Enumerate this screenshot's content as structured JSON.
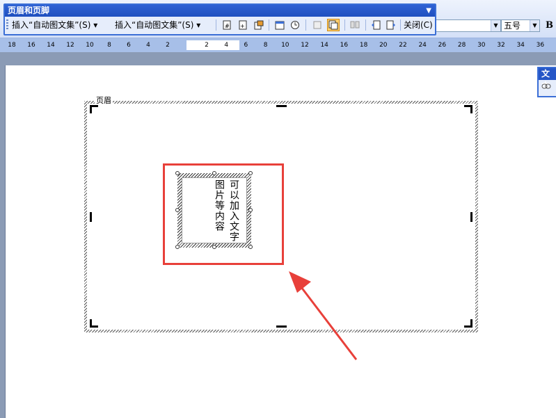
{
  "header_footer_toolbar": {
    "title": "页眉和页脚",
    "insert_autotext_1": "插入“自动图文集”(S)",
    "insert_autotext_2": "插入“自动图文集”(S)",
    "close_label": "关闭(C)"
  },
  "formatting": {
    "font_size": "五号",
    "bold_label": "B"
  },
  "ruler": {
    "left_numbers": [
      "18",
      "16",
      "14",
      "12",
      "10",
      "8",
      "6",
      "4",
      "2"
    ],
    "right_numbers": [
      "2",
      "4",
      "6",
      "8",
      "10",
      "12",
      "14",
      "16",
      "18",
      "20",
      "22",
      "24",
      "26",
      "28",
      "30",
      "32",
      "34",
      "36"
    ]
  },
  "document": {
    "header_label": "页眉",
    "textbox_line1": "可以加入文字",
    "textbox_line2": "图片等内容"
  },
  "side_panel": {
    "title": "文本"
  },
  "colors": {
    "title_bar": "#1f4fbf",
    "highlight": "#e8403a",
    "active_button": "#ffcf6e"
  }
}
